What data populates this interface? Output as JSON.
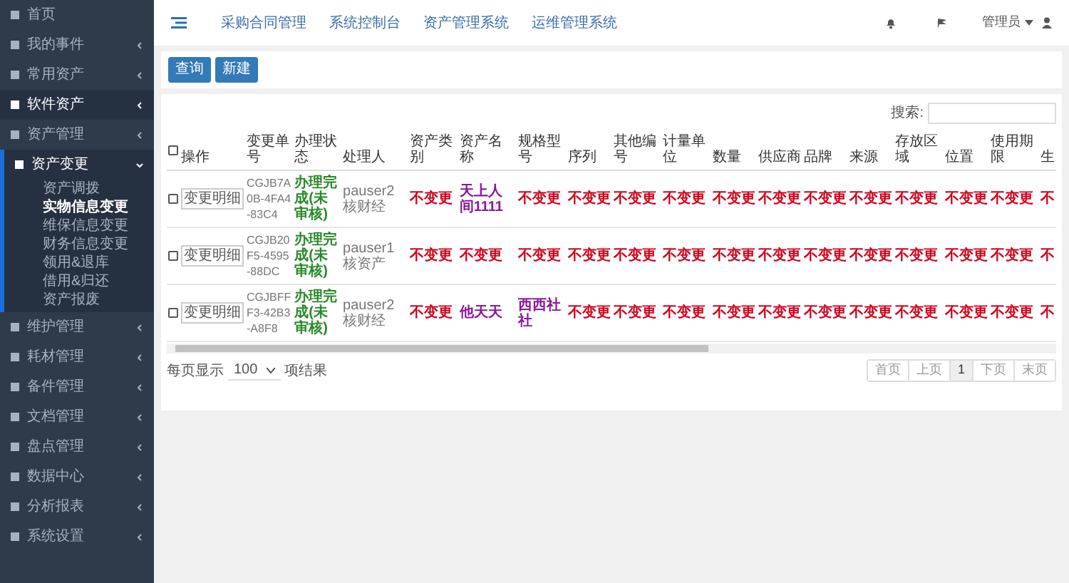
{
  "sidebar": {
    "items": [
      {
        "label": "首页",
        "selected": false
      },
      {
        "label": "我的事件",
        "selected": false,
        "expanded": false
      },
      {
        "label": "常用资产",
        "selected": false,
        "expanded": false
      },
      {
        "label": "软件资产",
        "selected": true,
        "expanded": false
      },
      {
        "label": "资产管理",
        "selected": false,
        "expanded": false
      },
      {
        "label": "资产变更",
        "selected": false,
        "expanded": true,
        "children": [
          {
            "label": "资产调拨",
            "selected": false
          },
          {
            "label": "实物信息变更",
            "selected": true
          },
          {
            "label": "维保信息变更",
            "selected": false
          },
          {
            "label": "财务信息变更",
            "selected": false
          },
          {
            "label": "领用&退库",
            "selected": false
          },
          {
            "label": "借用&归还",
            "selected": false
          },
          {
            "label": "资产报废",
            "selected": false
          }
        ]
      },
      {
        "label": "维护管理",
        "selected": false,
        "expanded": false
      },
      {
        "label": "耗材管理",
        "selected": false,
        "expanded": false
      },
      {
        "label": "备件管理",
        "selected": false,
        "expanded": false
      },
      {
        "label": "文档管理",
        "selected": false,
        "expanded": false
      },
      {
        "label": "盘点管理",
        "selected": false,
        "expanded": false
      },
      {
        "label": "数据中心",
        "selected": false,
        "expanded": false
      },
      {
        "label": "分析报表",
        "selected": false,
        "expanded": false
      },
      {
        "label": "系统设置",
        "selected": false,
        "expanded": false
      }
    ]
  },
  "topbar": {
    "links": [
      "采购合同管理",
      "系统控制台",
      "资产管理系统",
      "运维管理系统"
    ],
    "user": "管理员"
  },
  "toolbar": {
    "buttons": [
      "查询",
      "新建"
    ]
  },
  "search": {
    "label": "搜索:"
  },
  "table": {
    "select_all": {
      "checked": false
    },
    "columns": [
      "操作",
      "变更单号",
      "办理状态",
      "处理人",
      "资产类别",
      "资产名称",
      "规格型号",
      "序列",
      "其他编号",
      "计量单位",
      "数量",
      "供应商",
      "品牌",
      "来源",
      "存放区域",
      "位置",
      "使用期限",
      "生"
    ],
    "rows": [
      {
        "checked": false,
        "cells": [
          {
            "text": "变更明细",
            "kind": "button"
          },
          {
            "text": "CGJB7A0B-4FA4-83C4",
            "kind": "id"
          },
          {
            "text": "办理完成(未审核)",
            "kind": "status"
          },
          {
            "text": "pauser2核财经",
            "kind": "plain"
          },
          {
            "text": "不变更",
            "kind": "unchanged"
          },
          {
            "text": "天上人间1111",
            "kind": "changed"
          },
          {
            "text": "不变更",
            "kind": "unchanged"
          },
          {
            "text": "不变更",
            "kind": "unchanged"
          },
          {
            "text": "不变更",
            "kind": "unchanged"
          },
          {
            "text": "不变更",
            "kind": "unchanged"
          },
          {
            "text": "不变更",
            "kind": "unchanged"
          },
          {
            "text": "不变更",
            "kind": "unchanged"
          },
          {
            "text": "不变更",
            "kind": "unchanged"
          },
          {
            "text": "不变更",
            "kind": "unchanged"
          },
          {
            "text": "不变更",
            "kind": "unchanged"
          },
          {
            "text": "不变更",
            "kind": "unchanged"
          },
          {
            "text": "不变更",
            "kind": "unchanged"
          },
          {
            "text": "不",
            "kind": "unchanged"
          }
        ]
      },
      {
        "checked": false,
        "cells": [
          {
            "text": "变更明细",
            "kind": "button"
          },
          {
            "text": "CGJB20F5-4595-88DC",
            "kind": "id"
          },
          {
            "text": "办理完成(未审核)",
            "kind": "status"
          },
          {
            "text": "pauser1核资产",
            "kind": "plain"
          },
          {
            "text": "不变更",
            "kind": "unchanged"
          },
          {
            "text": "不变更",
            "kind": "unchanged"
          },
          {
            "text": "不变更",
            "kind": "unchanged"
          },
          {
            "text": "不变更",
            "kind": "unchanged"
          },
          {
            "text": "不变更",
            "kind": "unchanged"
          },
          {
            "text": "不变更",
            "kind": "unchanged"
          },
          {
            "text": "不变更",
            "kind": "unchanged"
          },
          {
            "text": "不变更",
            "kind": "unchanged"
          },
          {
            "text": "不变更",
            "kind": "unchanged"
          },
          {
            "text": "不变更",
            "kind": "unchanged"
          },
          {
            "text": "不变更",
            "kind": "unchanged"
          },
          {
            "text": "不变更",
            "kind": "unchanged"
          },
          {
            "text": "不变更",
            "kind": "unchanged"
          },
          {
            "text": "不",
            "kind": "unchanged"
          }
        ]
      },
      {
        "checked": false,
        "cells": [
          {
            "text": "变更明细",
            "kind": "button"
          },
          {
            "text": "CGJBFFF3-42B3-A8F8",
            "kind": "id"
          },
          {
            "text": "办理完成(未审核)",
            "kind": "status"
          },
          {
            "text": "pauser2核财经",
            "kind": "plain"
          },
          {
            "text": "不变更",
            "kind": "unchanged"
          },
          {
            "text": "他天天",
            "kind": "changed"
          },
          {
            "text": "西西社社",
            "kind": "changed"
          },
          {
            "text": "不变更",
            "kind": "unchanged"
          },
          {
            "text": "不变更",
            "kind": "unchanged"
          },
          {
            "text": "不变更",
            "kind": "unchanged"
          },
          {
            "text": "不变更",
            "kind": "unchanged"
          },
          {
            "text": "不变更",
            "kind": "unchanged"
          },
          {
            "text": "不变更",
            "kind": "unchanged"
          },
          {
            "text": "不变更",
            "kind": "unchanged"
          },
          {
            "text": "不变更",
            "kind": "unchanged"
          },
          {
            "text": "不变更",
            "kind": "unchanged"
          },
          {
            "text": "不变更",
            "kind": "unchanged"
          },
          {
            "text": "不",
            "kind": "unchanged"
          }
        ]
      }
    ]
  },
  "footer": {
    "page_size_label": "每页显示",
    "page_size": "100",
    "suffix": "项结果",
    "pagination": [
      {
        "label": "首页",
        "selected": false
      },
      {
        "label": "上页",
        "selected": false
      },
      {
        "label": "1",
        "selected": true
      },
      {
        "label": "下页",
        "selected": false
      },
      {
        "label": "末页",
        "selected": false
      }
    ]
  }
}
